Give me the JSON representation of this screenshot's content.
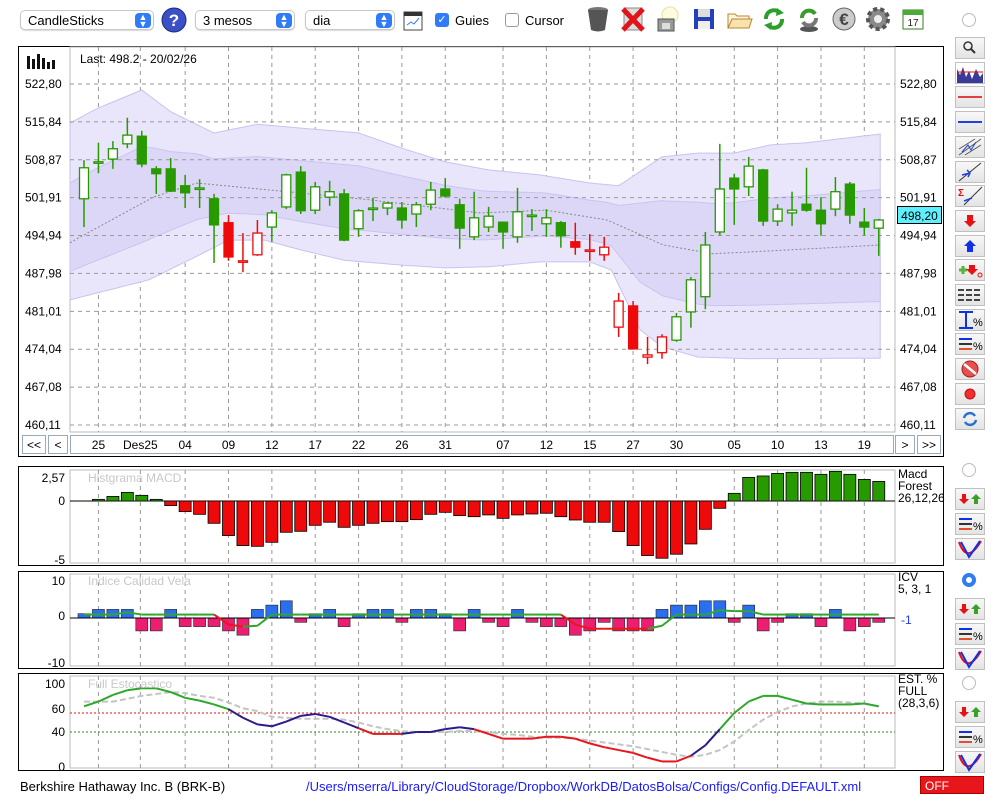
{
  "toolbar": {
    "chart_type": "CandleSticks",
    "period": "3 mesos",
    "interval": "dia",
    "guides_label": "Guies",
    "guides_checked": true,
    "cursor_label": "Cursor",
    "cursor_checked": false,
    "icons": [
      "help-icon",
      "chart-window-icon",
      "trash-icon",
      "delete-icon",
      "lamp-icon",
      "save-icon",
      "open-folder-icon",
      "refresh-icon",
      "money-refresh-icon",
      "euro-icon",
      "gear-icon",
      "calendar-icon"
    ],
    "calendar_day": "17"
  },
  "colors": {
    "up": "#279a00",
    "down": "#ee0a0a",
    "band_outer": "#e9e6fb",
    "band_inner": "#ddd7f7",
    "accent": "#2f7cf6",
    "blue_bar": "#2a6ff0",
    "pink_bar": "#ec1e72",
    "navy": "#2b1a8a"
  },
  "main": {
    "last_label": "Last: 498.2 - 20/02/26",
    "current_price": "498,20",
    "price_ticks": [
      {
        "label": "522,80",
        "v": 522.8
      },
      {
        "label": "515,84",
        "v": 515.84
      },
      {
        "label": "508,87",
        "v": 508.87
      },
      {
        "label": "501,91",
        "v": 501.91
      },
      {
        "label": "494,94",
        "v": 494.94
      },
      {
        "label": "487,98",
        "v": 487.98
      },
      {
        "label": "481,01",
        "v": 481.01
      },
      {
        "label": "474,04",
        "v": 474.04
      },
      {
        "label": "467,08",
        "v": 467.08
      },
      {
        "label": "460,11",
        "v": 460.11
      }
    ],
    "price_range": [
      460.11,
      522.8
    ],
    "candles": [
      [
        501.7,
        508.8,
        496.5,
        507.4,
        "g"
      ],
      [
        508.5,
        512.0,
        506.4,
        508.5,
        "g"
      ],
      [
        509.0,
        512.3,
        507.2,
        510.9,
        "g"
      ],
      [
        511.8,
        516.6,
        511.0,
        513.4,
        "g"
      ],
      [
        513.2,
        514.2,
        507.5,
        508.1,
        "g"
      ],
      [
        507.2,
        507.7,
        502.6,
        506.3,
        "g"
      ],
      [
        507.2,
        509.2,
        503.0,
        503.1,
        "g"
      ],
      [
        504.1,
        506.1,
        500.0,
        502.8,
        "g"
      ],
      [
        503.7,
        505.3,
        500.0,
        503.7,
        "g"
      ],
      [
        501.7,
        502.6,
        489.9,
        496.9,
        "g"
      ],
      [
        497.3,
        498.7,
        490.3,
        491.0,
        "r"
      ],
      [
        490.3,
        495.4,
        488.2,
        490.3,
        "r"
      ],
      [
        491.4,
        497.8,
        491.2,
        495.4,
        "r"
      ],
      [
        496.5,
        499.6,
        493.8,
        499.1,
        "g"
      ],
      [
        500.2,
        506.3,
        499.8,
        506.1,
        "g"
      ],
      [
        506.6,
        507.7,
        498.9,
        499.5,
        "g"
      ],
      [
        499.6,
        504.8,
        498.9,
        503.9,
        "g"
      ],
      [
        502.0,
        505.0,
        500.4,
        503.0,
        "g"
      ],
      [
        502.6,
        503.5,
        493.9,
        494.1,
        "g"
      ],
      [
        496.2,
        499.8,
        494.7,
        499.5,
        "g"
      ],
      [
        500.0,
        501.9,
        497.6,
        500.0,
        "g"
      ],
      [
        500.0,
        501.1,
        498.7,
        500.9,
        "g"
      ],
      [
        500.0,
        501.1,
        496.2,
        497.8,
        "g"
      ],
      [
        498.9,
        501.1,
        496.5,
        500.6,
        "g"
      ],
      [
        500.7,
        504.8,
        499.6,
        503.3,
        "g"
      ],
      [
        503.5,
        505.5,
        501.9,
        502.2,
        "g"
      ],
      [
        500.6,
        501.7,
        492.5,
        496.3,
        "g"
      ],
      [
        494.7,
        503.0,
        494.1,
        498.2,
        "g"
      ],
      [
        496.5,
        500.2,
        495.6,
        498.5,
        "g"
      ],
      [
        497.4,
        497.4,
        492.5,
        495.6,
        "g"
      ],
      [
        494.7,
        503.7,
        493.6,
        499.3,
        "g"
      ],
      [
        498.7,
        499.8,
        495.8,
        498.7,
        "g"
      ],
      [
        497.1,
        499.8,
        494.7,
        498.2,
        "g"
      ],
      [
        497.3,
        497.6,
        492.7,
        494.9,
        "g"
      ],
      [
        493.8,
        497.3,
        491.4,
        492.8,
        "r"
      ],
      [
        492.3,
        495.2,
        490.3,
        492.3,
        "r"
      ],
      [
        491.4,
        494.7,
        490.3,
        492.8,
        "r"
      ],
      [
        478.1,
        484.4,
        476.3,
        482.9,
        "r"
      ],
      [
        482.0,
        482.9,
        474.1,
        474.1,
        "r"
      ],
      [
        472.6,
        476.3,
        471.3,
        473.0,
        "r"
      ],
      [
        473.4,
        476.8,
        472.3,
        476.3,
        "r"
      ],
      [
        475.7,
        480.7,
        475.4,
        480.0,
        "g"
      ],
      [
        480.9,
        487.3,
        478.0,
        486.8,
        "g"
      ],
      [
        483.7,
        495.6,
        481.4,
        493.2,
        "g"
      ],
      [
        495.6,
        511.8,
        495.0,
        503.5,
        "g"
      ],
      [
        505.5,
        506.3,
        496.9,
        503.5,
        "g"
      ],
      [
        503.9,
        509.4,
        502.2,
        507.7,
        "g"
      ],
      [
        507.0,
        507.2,
        496.7,
        497.6,
        "g"
      ],
      [
        497.6,
        500.7,
        496.7,
        499.8,
        "g"
      ],
      [
        499.1,
        503.0,
        496.7,
        499.6,
        "g"
      ],
      [
        500.7,
        507.4,
        499.3,
        499.6,
        "g"
      ],
      [
        499.6,
        502.0,
        494.9,
        497.1,
        "g"
      ],
      [
        499.8,
        505.7,
        498.5,
        503.0,
        "g"
      ],
      [
        504.4,
        504.8,
        497.1,
        498.7,
        "g"
      ],
      [
        497.4,
        500.0,
        495.0,
        496.5,
        "g"
      ],
      [
        496.3,
        498.0,
        491.2,
        497.8,
        "g"
      ]
    ],
    "bands": {
      "middle": [
        [
          -1,
          493.6
        ],
        [
          4.8,
          502.0
        ],
        [
          7.8,
          504.6
        ],
        [
          12.9,
          503.3
        ],
        [
          19.8,
          501.5
        ],
        [
          27.4,
          499.1
        ],
        [
          32,
          499.6
        ],
        [
          36.2,
          497.8
        ],
        [
          40.1,
          493.2
        ],
        [
          43.5,
          491.6
        ],
        [
          45.9,
          491.9
        ],
        [
          55.1,
          493.2
        ]
      ],
      "upper": [
        [
          -1,
          515.6
        ],
        [
          1,
          518.4
        ],
        [
          4,
          521.7
        ],
        [
          6,
          517.7
        ],
        [
          9,
          513.8
        ],
        [
          12,
          515.4
        ],
        [
          15,
          514.7
        ],
        [
          19,
          513.8
        ],
        [
          22,
          511.0
        ],
        [
          25,
          508.5
        ],
        [
          28,
          507.0
        ],
        [
          31.5,
          506.1
        ],
        [
          35,
          504.6
        ],
        [
          37,
          504.1
        ],
        [
          40,
          509.4
        ],
        [
          42.5,
          510.1
        ],
        [
          45,
          510.1
        ],
        [
          47.5,
          511.6
        ],
        [
          50,
          512.0
        ],
        [
          55.1,
          513.6
        ]
      ],
      "lower": [
        [
          -1,
          483.1
        ],
        [
          4.5,
          486.8
        ],
        [
          8,
          491.4
        ],
        [
          10,
          494.1
        ],
        [
          12.5,
          494.1
        ],
        [
          15,
          492.3
        ],
        [
          18,
          490.4
        ],
        [
          22,
          489.5
        ],
        [
          25,
          489.0
        ],
        [
          28,
          489.2
        ],
        [
          31.5,
          490.1
        ],
        [
          35,
          490.1
        ],
        [
          36.5,
          488.6
        ],
        [
          38.5,
          477.6
        ],
        [
          40,
          474.5
        ],
        [
          42.5,
          472.6
        ],
        [
          46,
          472.3
        ],
        [
          55.1,
          472.4
        ]
      ]
    },
    "date_labels": [
      [
        "25",
        1
      ],
      [
        "Des25",
        3.9
      ],
      [
        "04",
        7
      ],
      [
        "09",
        10
      ],
      [
        "12",
        13
      ],
      [
        "17",
        16
      ],
      [
        "22",
        19
      ],
      [
        "26",
        22
      ],
      [
        "31",
        25
      ],
      [
        "07",
        29
      ],
      [
        "12",
        32
      ],
      [
        "15",
        35
      ],
      [
        "27",
        38
      ],
      [
        "30",
        41
      ],
      [
        "05",
        45
      ],
      [
        "10",
        48
      ],
      [
        "13",
        51
      ],
      [
        "19",
        54
      ]
    ],
    "nav": {
      "first": "<<",
      "prev": "<",
      "next": ">",
      "last": ">>"
    },
    "sidebar_tools": [
      "zoom-icon",
      "chart-overview-icon",
      "red-hline-icon",
      "blue-hline-icon",
      "channel-icon",
      "trendline-icon",
      "sigma-trendline-icon",
      "sell-arrow-icon",
      "buy-arrow-icon",
      "add-signal-icon",
      "dashed-lines-icon",
      "percent-range-icon",
      "percent-lines-icon",
      "stop-icon",
      "record-icon",
      "refresh-icon"
    ]
  },
  "macd": {
    "title": "Histgrama MACD",
    "legend": [
      "Macd",
      "Forest",
      "26,12,26"
    ],
    "ticks": [
      {
        "label": "2,57",
        "v": 2.57
      },
      {
        "label": "0",
        "v": 0
      },
      {
        "label": "-5",
        "v": -5
      }
    ],
    "values": [
      0,
      0.14,
      0.39,
      0.73,
      0.48,
      0.14,
      -0.39,
      -0.9,
      -1.13,
      -1.89,
      -2.93,
      -3.78,
      -3.84,
      -3.5,
      -2.65,
      -2.57,
      -2.06,
      -1.8,
      -2.23,
      -2.06,
      -1.89,
      -1.75,
      -1.75,
      -1.58,
      -1.13,
      -0.96,
      -1.24,
      -1.33,
      -1.18,
      -1.47,
      -1.18,
      -1.1,
      -1.04,
      -1.33,
      -1.61,
      -1.8,
      -1.8,
      -2.59,
      -3.78,
      -4.62,
      -4.85,
      -4.51,
      -3.64,
      -2.4,
      -0.62,
      0.65,
      2.0,
      2.12,
      2.34,
      2.43,
      2.43,
      2.26,
      2.51,
      2.26,
      1.83,
      1.66
    ]
  },
  "icv": {
    "title": "Indice Calidad Vela",
    "legend": [
      "ICV",
      "5, 3, 1"
    ],
    "level_label": "-1",
    "ticks": [
      {
        "label": "10",
        "v": 10
      },
      {
        "label": "0",
        "v": 0
      },
      {
        "label": "-10",
        "v": -10
      }
    ],
    "values": [
      1,
      2,
      2,
      2,
      -3,
      -3,
      2,
      -2,
      -2,
      -2,
      -3,
      -4,
      2,
      3,
      4,
      -1,
      1,
      2,
      -2,
      1,
      2,
      2,
      -1,
      2,
      2,
      1,
      -3,
      2,
      -1,
      -2,
      2,
      -1,
      -2,
      -2,
      -4,
      -3,
      -1,
      -3,
      -3,
      -3,
      2,
      3,
      3,
      4,
      4,
      -1,
      3,
      -3,
      -1,
      1,
      1,
      -2,
      2,
      -3,
      -2,
      -1
    ],
    "line": [
      0.8,
      0.8,
      0.8,
      1.3,
      0.8,
      0.8,
      0.8,
      0.8,
      0.8,
      0.8,
      -1.5,
      -2.0,
      -1.8,
      0.8,
      0.8,
      0.8,
      0.8,
      0.8,
      0.8,
      0.8,
      0.8,
      0.8,
      0.8,
      0.8,
      0.8,
      0.8,
      0.8,
      0.8,
      0.8,
      0.8,
      0.8,
      0.8,
      0.8,
      0.8,
      -1.5,
      -2.5,
      -2.5,
      -2.5,
      -2.5,
      -2.5,
      -1.8,
      0.8,
      0.8,
      0.8,
      1.8,
      1.6,
      1.6,
      0.8,
      0.8,
      0.8,
      0.8,
      0.8,
      0.8,
      0.8,
      0.8,
      0.8
    ]
  },
  "stoch": {
    "title": "Full Estocastico",
    "legend": [
      "EST. %",
      "FULL",
      "(28,3,6)"
    ],
    "ticks": [
      {
        "label": "100",
        "v": 100
      },
      {
        "label": "60",
        "v": 60
      },
      {
        "label": "40",
        "v": 40
      },
      {
        "label": "0",
        "v": 0
      }
    ],
    "levels": [
      60,
      40
    ],
    "k": [
      67,
      72,
      79,
      84,
      86,
      86,
      82,
      76,
      73,
      69,
      64,
      55,
      48,
      46,
      51,
      57,
      59,
      56,
      50,
      44,
      38,
      38,
      38,
      40,
      40,
      43,
      45,
      43,
      38,
      33,
      33,
      33,
      35,
      35,
      33,
      28,
      24,
      21,
      18,
      13,
      9,
      9,
      15,
      26,
      43,
      60,
      72,
      78,
      78,
      74,
      70,
      69,
      69,
      69,
      70,
      67
    ],
    "k_state": "gggggggggggbbbbbbbbbrrrbbbbbrrrrrrrrrrrrrrrbbggggggggggg",
    "d": [
      72,
      72,
      72,
      75,
      78,
      80,
      82,
      81,
      78,
      76,
      71,
      65,
      62,
      56,
      55,
      54,
      54,
      54,
      53,
      50,
      46,
      43,
      41,
      40,
      40,
      40,
      41,
      41,
      40,
      38,
      37,
      35,
      34,
      34,
      33,
      31,
      29,
      27,
      25,
      22,
      19,
      16,
      14,
      16,
      21,
      30,
      42,
      53,
      61,
      67,
      70,
      72,
      72,
      71,
      70,
      67
    ]
  },
  "footer": {
    "instrument": "Berkshire Hathaway Inc. B (BRK-B)",
    "config_path": "/Users/mserra/Library/CloudStorage/Dropbox/WorkDB/DatosBolsa/Configs/Config.DEFAULT.xml",
    "status": "OFF"
  }
}
